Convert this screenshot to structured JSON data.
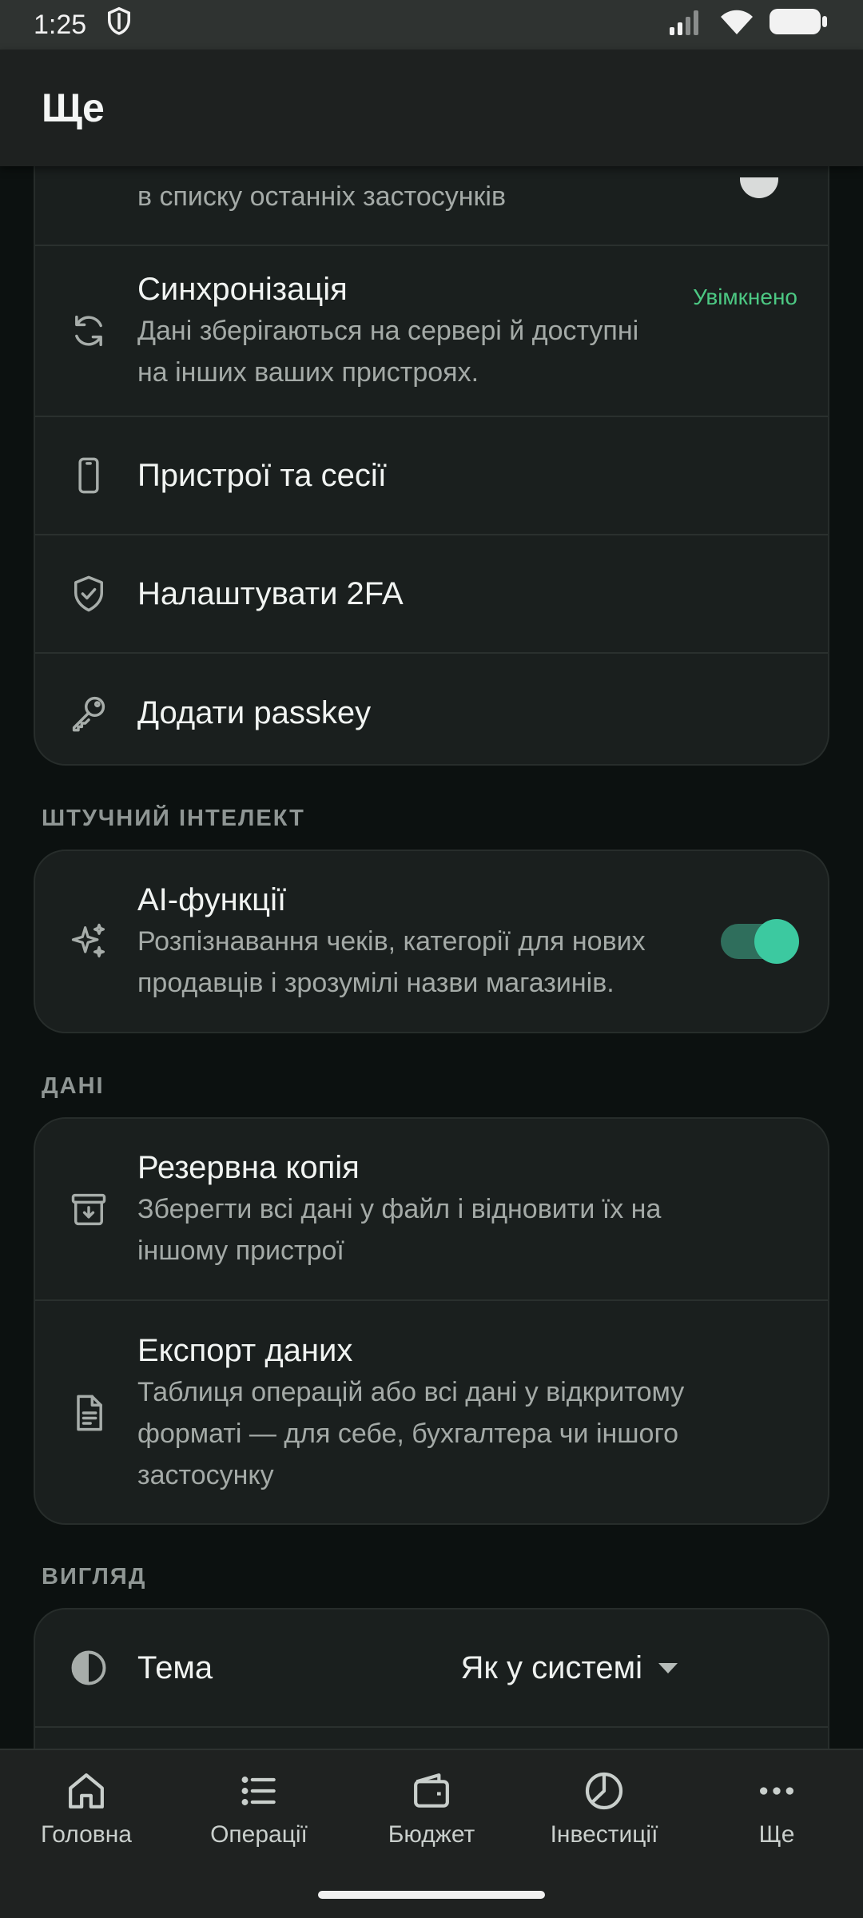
{
  "status_bar": {
    "time": "1:25"
  },
  "app_bar": {
    "title": "Ще"
  },
  "security_card": {
    "partial_row": {
      "description": "в списку останніх застосунків"
    },
    "sync": {
      "title": "Синхронізація",
      "description": "Дані зберігаються на сервері й доступні на інших ваших пристроях.",
      "status": "Увімкнено"
    },
    "devices": {
      "title": "Пристрої та сесії"
    },
    "twofa": {
      "title": "Налаштувати 2FA"
    },
    "passkey": {
      "title": "Додати passkey"
    }
  },
  "ai_section": {
    "label": "ШТУЧНИЙ ІНТЕЛЕКТ",
    "ai_features": {
      "title": "AI-функції",
      "description": "Розпізнавання чеків, категорії для нових продавців і зрозумілі назви магазинів.",
      "enabled": true
    }
  },
  "data_section": {
    "label": "ДАНІ",
    "backup": {
      "title": "Резервна копія",
      "description": "Зберегти всі дані у файл і відновити їх на іншому пристрої"
    },
    "export": {
      "title": "Експорт даних",
      "description": "Таблиця операцій або всі дані у відкритому форматі — для себе, бухгалтера чи іншого застосунку"
    }
  },
  "appearance_section": {
    "label": "ВИГЛЯД",
    "theme": {
      "title": "Тема",
      "value": "Як у системі"
    }
  },
  "bottom_nav": [
    {
      "label": "Головна",
      "icon": "home-icon"
    },
    {
      "label": "Операції",
      "icon": "list-icon"
    },
    {
      "label": "Бюджет",
      "icon": "wallet-icon"
    },
    {
      "label": "Інвестиції",
      "icon": "pie-chart-icon"
    },
    {
      "label": "Ще",
      "icon": "more-icon"
    }
  ],
  "colors": {
    "accent": "#3cc9a0",
    "status_on": "#4cc883",
    "background": "#0c1110",
    "card": "#1a1f1e"
  }
}
